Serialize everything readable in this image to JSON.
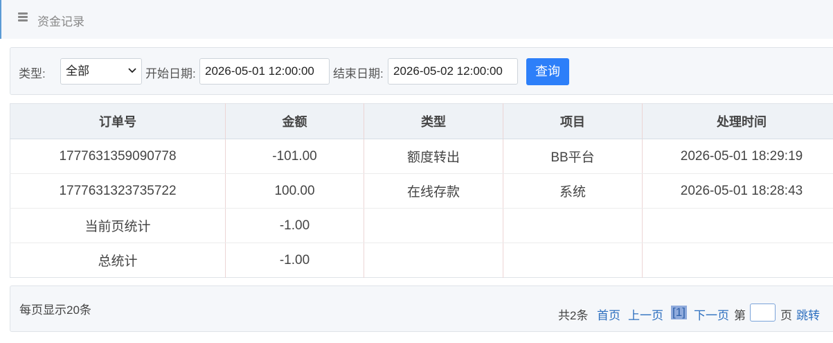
{
  "header": {
    "title": "资金记录",
    "menu_icon": "menu-icon"
  },
  "filters": {
    "type_label": "类型:",
    "type_value": "全部",
    "start_label": "开始日期:",
    "start_value": "2026-05-01 12:00:00",
    "end_label": "结束日期:",
    "end_value": "2026-05-02 12:00:00",
    "query_label": "查询"
  },
  "table": {
    "columns": [
      "订单号",
      "金额",
      "类型",
      "项目",
      "处理时间"
    ],
    "rows": [
      [
        "1777631359090778",
        "-101.00",
        "额度转出",
        "BB平台",
        "2026-05-01 18:29:19"
      ],
      [
        "1777631323735722",
        "100.00",
        "在线存款",
        "系统",
        "2026-05-01 18:28:43"
      ]
    ],
    "summary": [
      {
        "label": "当前页统计",
        "amount": "-1.00"
      },
      {
        "label": "总统计",
        "amount": "-1.00"
      }
    ]
  },
  "pager": {
    "page_size_text": "每页显示20条",
    "total_text": "共2条",
    "first": "首页",
    "prev": "上一页",
    "current": "[1]",
    "next": "下一页",
    "page_prefix": "第",
    "page_suffix": "页",
    "jump": "跳转",
    "jump_value": ""
  },
  "colors": {
    "accent": "#2d7ff9",
    "link": "#2d6fbf",
    "current_page_bg": "#8faadc"
  }
}
